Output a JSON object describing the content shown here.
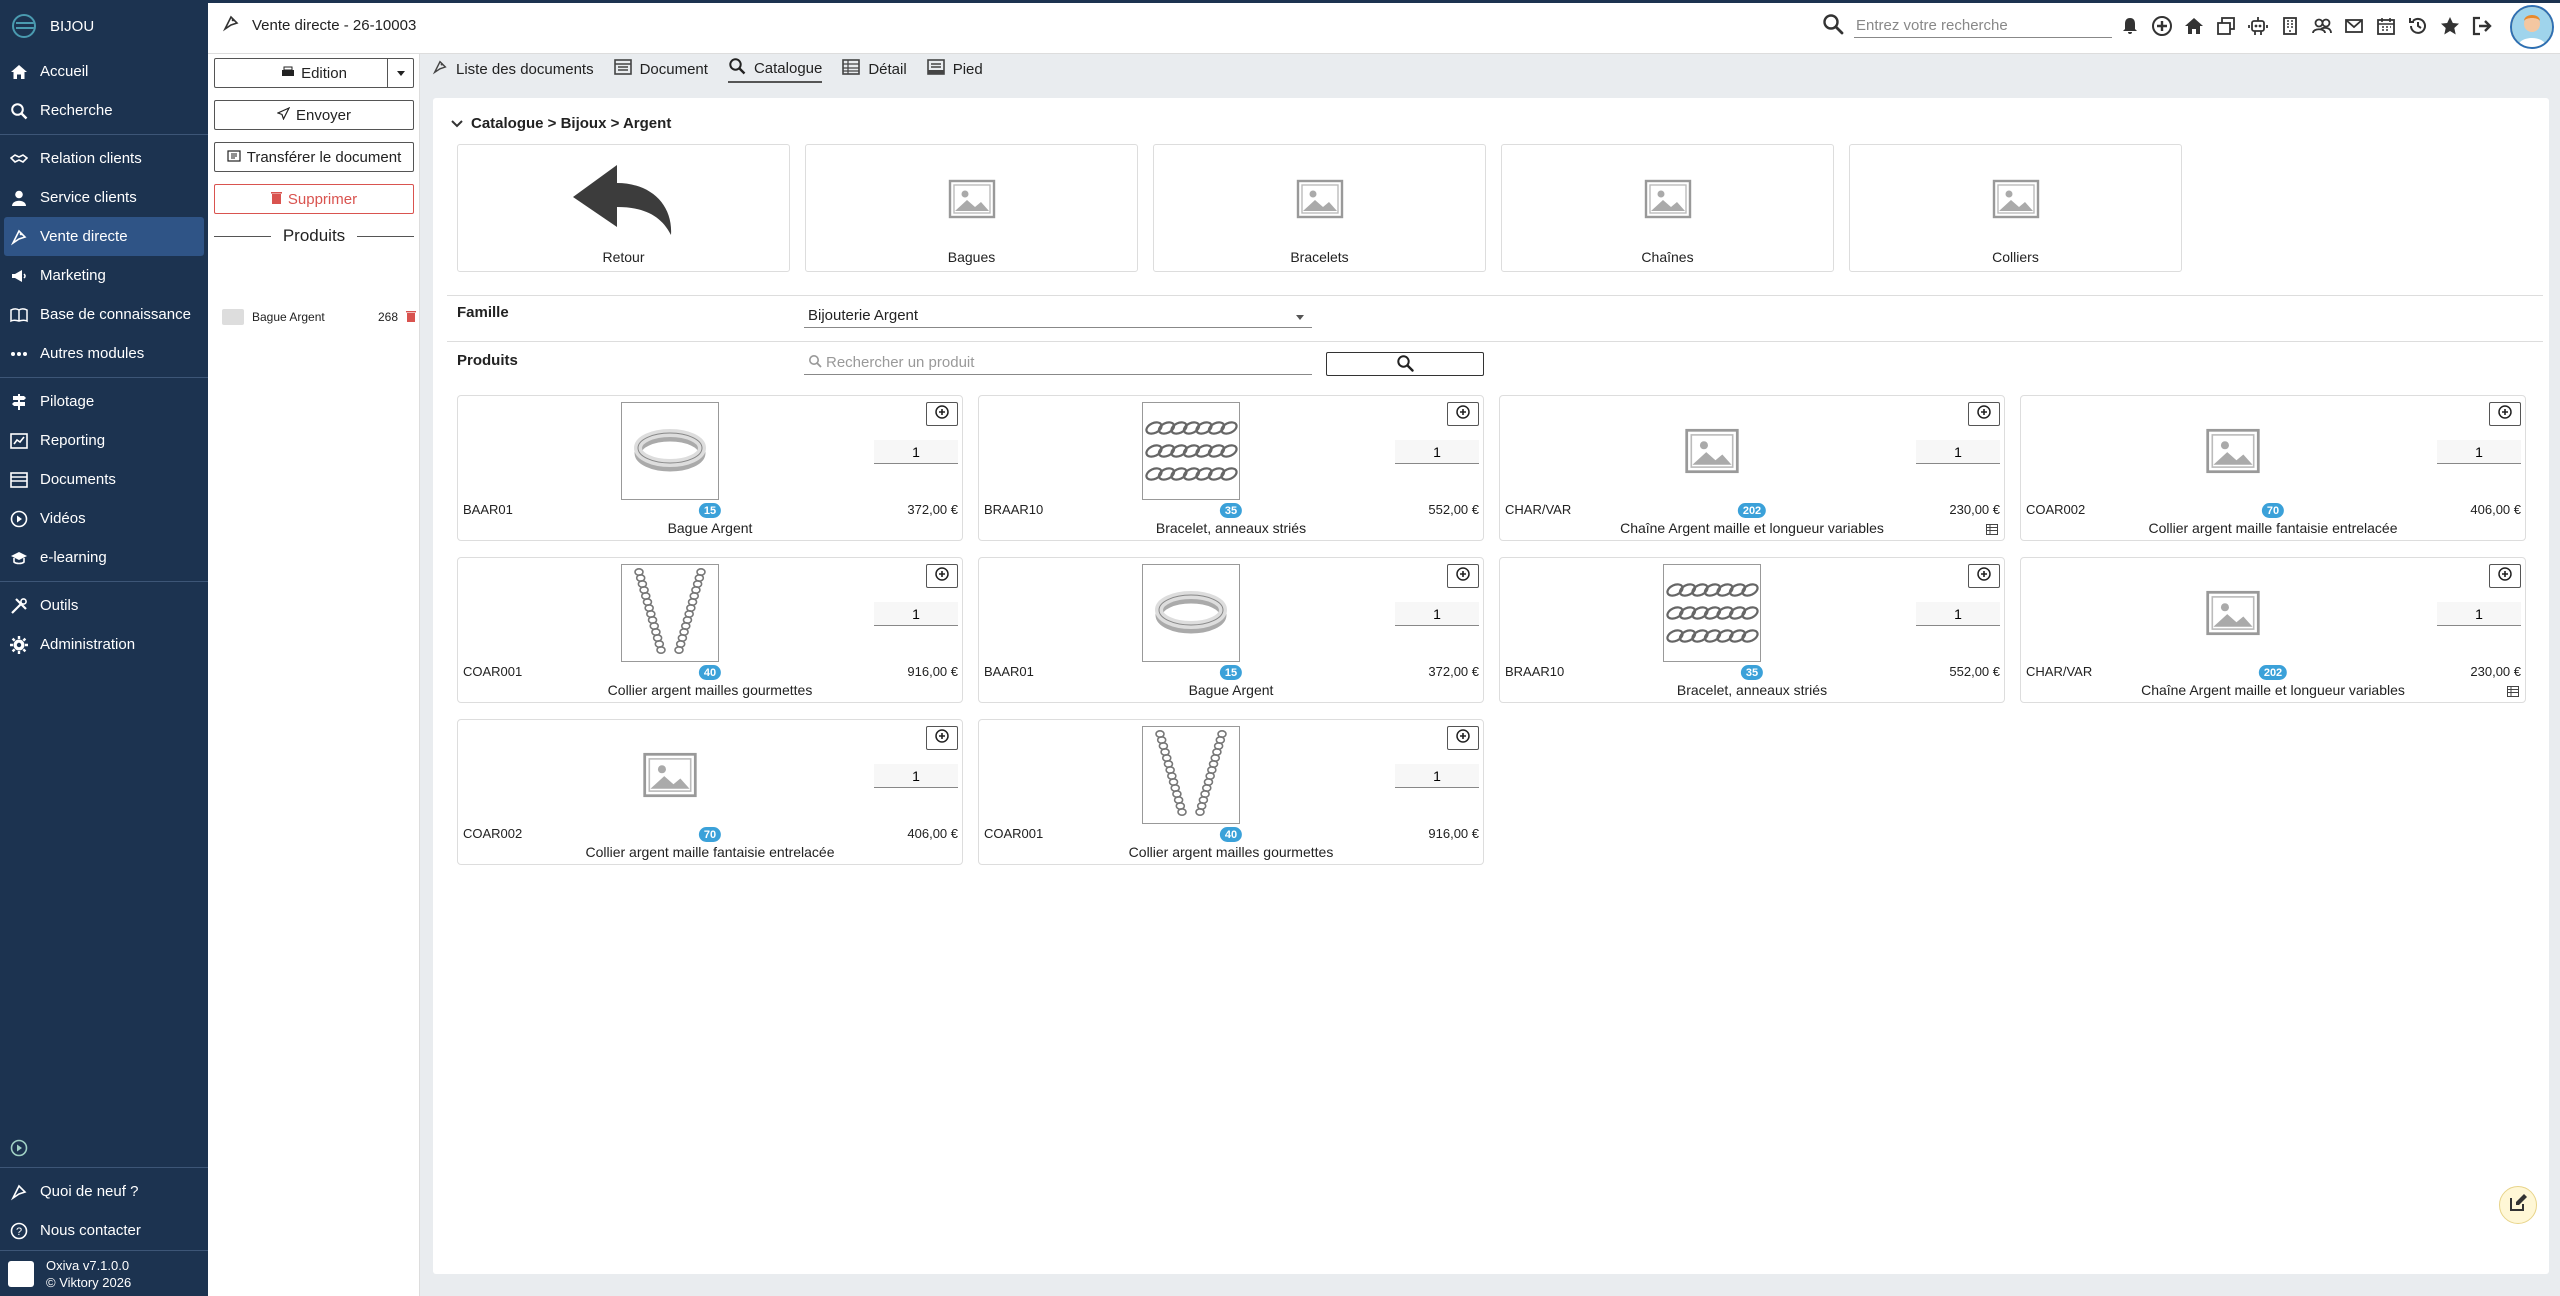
{
  "app": {
    "name": "BIJOU",
    "window_title": "Vente directe - 26-10003",
    "version": "Oxiva v7.1.0.0",
    "copyright": "© Viktory 2026"
  },
  "search": {
    "placeholder": "Entrez votre recherche"
  },
  "sidebar": {
    "items": [
      {
        "label": "Accueil",
        "icon": "home-icon"
      },
      {
        "label": "Recherche",
        "icon": "search-icon"
      },
      {
        "label": "Relation clients",
        "icon": "handshake-icon"
      },
      {
        "label": "Service clients",
        "icon": "user-icon"
      },
      {
        "label": "Vente directe",
        "icon": "sale-icon",
        "active": true
      },
      {
        "label": "Marketing",
        "icon": "megaphone-icon"
      },
      {
        "label": "Base de connaissance",
        "icon": "book-icon"
      },
      {
        "label": "Autres modules",
        "icon": "dots-icon"
      },
      {
        "label": "Pilotage",
        "icon": "signpost-icon"
      },
      {
        "label": "Reporting",
        "icon": "report-icon"
      },
      {
        "label": "Documents",
        "icon": "documents-icon"
      },
      {
        "label": "Vidéos",
        "icon": "play-icon"
      },
      {
        "label": "e-learning",
        "icon": "graduation-icon"
      },
      {
        "label": "Outils",
        "icon": "tools-icon"
      },
      {
        "label": "Administration",
        "icon": "gear-icon"
      }
    ],
    "bottom": [
      {
        "label": "Quoi de neuf ?",
        "icon": "news-icon"
      },
      {
        "label": "Nous contacter",
        "icon": "help-icon"
      }
    ]
  },
  "actions": {
    "edition": "Edition",
    "envoyer": "Envoyer",
    "transferer": "Transférer le document",
    "supprimer": "Supprimer",
    "produits_title": "Produits",
    "cart": [
      {
        "name": "Bague Argent",
        "qty": "268"
      }
    ]
  },
  "tabs": [
    {
      "label": "Liste des documents",
      "icon": "sale-icon"
    },
    {
      "label": "Document",
      "icon": "document-icon"
    },
    {
      "label": "Catalogue",
      "icon": "search-icon",
      "active": true
    },
    {
      "label": "Détail",
      "icon": "table-icon"
    },
    {
      "label": "Pied",
      "icon": "footer-icon"
    }
  ],
  "catalogue": {
    "breadcrumb": "Catalogue > Bijoux > Argent",
    "categories": [
      "Retour",
      "Bagues",
      "Bracelets",
      "Chaînes",
      "Colliers"
    ],
    "famille_label": "Famille",
    "famille_value": "Bijouterie Argent",
    "produits_label": "Produits",
    "product_search_placeholder": "Rechercher un produit"
  },
  "products": [
    {
      "code": "BAAR01",
      "badge": "15",
      "price": "372,00 €",
      "name": "Bague Argent",
      "image": "ring",
      "qty": "1"
    },
    {
      "code": "BRAAR10",
      "badge": "35",
      "price": "552,00 €",
      "name": "Bracelet, anneaux striés",
      "image": "bracelet",
      "qty": "1"
    },
    {
      "code": "CHAR/VAR",
      "badge": "202",
      "price": "230,00 €",
      "name": "Chaîne Argent maille et longueur variables",
      "image": "none",
      "qty": "1",
      "variant": true
    },
    {
      "code": "COAR002",
      "badge": "70",
      "price": "406,00 €",
      "name": "Collier argent maille fantaisie entrelacée",
      "image": "none",
      "qty": "1"
    },
    {
      "code": "COAR001",
      "badge": "40",
      "price": "916,00 €",
      "name": "Collier argent mailles gourmettes",
      "image": "necklace",
      "qty": "1"
    },
    {
      "code": "BAAR01",
      "badge": "15",
      "price": "372,00 €",
      "name": "Bague Argent",
      "image": "ring",
      "qty": "1"
    },
    {
      "code": "BRAAR10",
      "badge": "35",
      "price": "552,00 €",
      "name": "Bracelet, anneaux striés",
      "image": "bracelet",
      "qty": "1"
    },
    {
      "code": "CHAR/VAR",
      "badge": "202",
      "price": "230,00 €",
      "name": "Chaîne Argent maille et longueur variables",
      "image": "none",
      "qty": "1",
      "variant": true
    },
    {
      "code": "COAR002",
      "badge": "70",
      "price": "406,00 €",
      "name": "Collier argent maille fantaisie entrelacée",
      "image": "none",
      "qty": "1"
    },
    {
      "code": "COAR001",
      "badge": "40",
      "price": "916,00 €",
      "name": "Collier argent mailles gourmettes",
      "image": "necklace",
      "qty": "1"
    }
  ],
  "colors": {
    "sidebar_bg": "#1c3350",
    "active_bg": "#2f5486",
    "badge": "#3ba1d9",
    "danger": "#d9534f"
  }
}
